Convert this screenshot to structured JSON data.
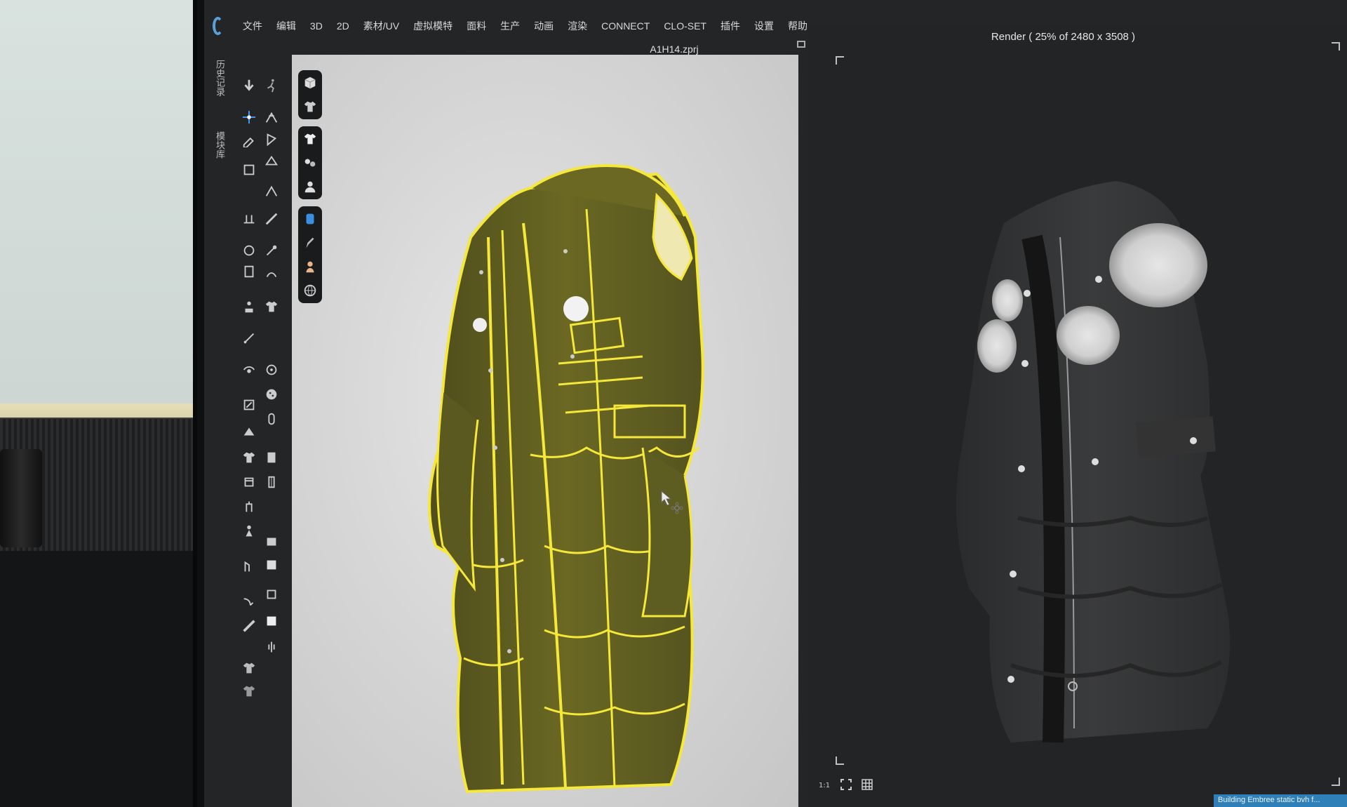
{
  "app": {
    "menu": [
      "文件",
      "编辑",
      "3D",
      "2D",
      "素材/UV",
      "虚拟模特",
      "面料",
      "生产",
      "动画",
      "渲染",
      "CONNECT",
      "CLO-SET",
      "插件",
      "设置",
      "帮助"
    ],
    "file_title": "A1H14.zprj",
    "vertical_tabs": [
      "历史记录",
      "模块库"
    ]
  },
  "toolbar": {
    "icons": [
      "move-down-icon",
      "walk-icon",
      "gizmo-move-icon",
      "arrange-icon",
      "edit-pattern-icon",
      "pin-icon",
      "fold-icon",
      "tack-icon",
      "garment-fit-icon",
      "sewing-icon",
      "measure-icon",
      "button-icon",
      "buttonhole-icon",
      "zipper-icon",
      "puckering-icon",
      "avatar-icon",
      "shirt-icon",
      "tape-icon"
    ]
  },
  "palette": {
    "groups": [
      [
        "cube-view-icon",
        "garment-view-icon"
      ],
      [
        "tshirt-icon",
        "fabric-icon",
        "avatar-show-icon"
      ],
      [
        "texture-icon",
        "pencil-icon",
        "skin-icon",
        "globe-icon"
      ]
    ]
  },
  "render": {
    "title": "Render ( 25% of 2480 x 3508 )",
    "status": "Building Embree static bvh f..."
  },
  "colors": {
    "accent": "#5aa0d8",
    "selection": "#ffec3d",
    "status": "#2f7fb8"
  }
}
